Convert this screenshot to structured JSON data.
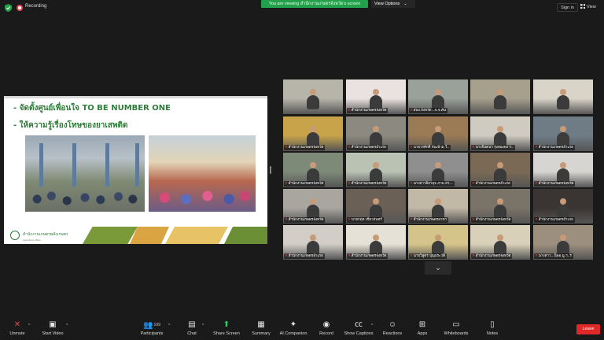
{
  "topbar": {
    "recording_label": "Recording",
    "viewing_banner": "You are viewing สำนักงานเกษตรจังหวัด's screen",
    "view_options": "View Options",
    "sign_in": "Sign in",
    "view": "View"
  },
  "slide": {
    "line1": "- จัดตั้งศูนย์เพื่อนใจ TO BE NUMBER ONE",
    "line2": "- ให้ความรู้เรื่องโทษของยาเสพติด",
    "org_name": "สำนักงานเกษตรพลังเกษตร",
    "org_sub": "Agriculture Office"
  },
  "gallery": {
    "tiles": [
      {
        "name": "",
        "bg": "#b7b4aa"
      },
      {
        "name": "สำนักงานเกษตรจังหวัด",
        "bg": "#e9e2e0"
      },
      {
        "name": "สนง.จังหวัด...จ.จ.คัน",
        "bg": "#9aa09a"
      },
      {
        "name": "",
        "bg": "#a69f8c"
      },
      {
        "name": "",
        "bg": "#d9d4c8"
      },
      {
        "name": "สำนักงานเกษตรจังหวัด",
        "bg": "#c8a34a"
      },
      {
        "name": "สำนักงานเกษตรอำเภอ",
        "bg": "#8c8a80"
      },
      {
        "name": "นายวรศักดิ์ จันเข้าม ใ..",
        "bg": "#9b7b55"
      },
      {
        "name": "นางจินตนา รุ่งทองพง ร..",
        "bg": "#cfcbc1"
      },
      {
        "name": "สำนักงานเกษตรอำเภอ",
        "bg": "#6f7c86"
      },
      {
        "name": "สำนักงานเกษตรจังหวัด",
        "bg": "#7e8a78"
      },
      {
        "name": "สำนักงานเกษตรจังหวัด",
        "bg": "#b9c2b3"
      },
      {
        "name": "นางสาวอิลาลุจ ภาพ สว...",
        "bg": "#8f8f8f"
      },
      {
        "name": "สำนักงานเกษตรอำเภอ",
        "bg": "#7a6a55"
      },
      {
        "name": "สำนักงานเกษตรจังหวัด",
        "bg": "#d7d5d1"
      },
      {
        "name": "สำนักงานเกษตรจังหวัด",
        "bg": "#a9a6a0"
      },
      {
        "name": "นายกฤต เขียวจันทร์",
        "bg": "#6b6055"
      },
      {
        "name": "สำนักงานเกษตรสาขา",
        "bg": "#c2b8a6"
      },
      {
        "name": "สำนักงานเกษตรจังหวัด",
        "bg": "#7a7468"
      },
      {
        "name": "สำนักงานเกษตรอำเภอ",
        "bg": "#3a3432"
      },
      {
        "name": "สำนักงานเกษตรอำเภอ",
        "bg": "#d2cdc6"
      },
      {
        "name": "สำนักงานเกษตรจังหวัด",
        "bg": "#e6e1d6"
      },
      {
        "name": "นายวิสูตร บุญประวัติ",
        "bg": "#d5c489"
      },
      {
        "name": "สำนักงานเกษตรจังหวัด",
        "bg": "#d8d0b8"
      },
      {
        "name": "นางสาว...นิลอ มู.ฯ..ร",
        "bg": "#9d8f7e"
      }
    ]
  },
  "toolbar": {
    "unmute": "Unmute",
    "start_video": "Start Video",
    "participants": "Participants",
    "participants_count": "109",
    "chat": "Chat",
    "share_screen": "Share Screen",
    "summary": "Summary",
    "ai_companion": "AI Companion",
    "record": "Record",
    "show_captions": "Show Captions",
    "reactions": "Reactions",
    "apps": "Apps",
    "whiteboards": "Whiteboards",
    "notes": "Notes",
    "leave": "Leave"
  },
  "colors": {
    "banner_green": "#23a04c",
    "leave_red": "#e02828",
    "active_speaker": "#d9e021",
    "slide_text_green": "#2f7d3a"
  }
}
